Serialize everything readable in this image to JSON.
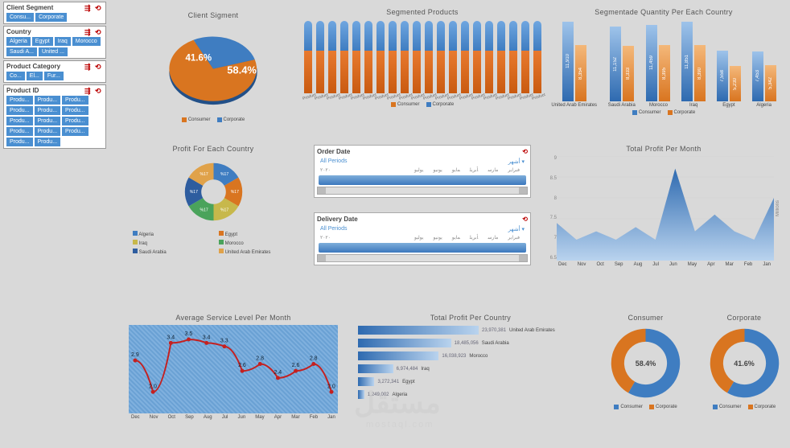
{
  "slicers": {
    "clientSegment": {
      "title": "Client Segment",
      "items": [
        "Consu...",
        "Corporate"
      ]
    },
    "country": {
      "title": "Country",
      "items": [
        "Algeria",
        "Egypt",
        "Iraq",
        "Morocco",
        "Saudi A...",
        "United ..."
      ]
    },
    "productCategory": {
      "title": "Product Category",
      "items": [
        "Co...",
        "El...",
        "Fur..."
      ]
    },
    "productId": {
      "title": "Product ID",
      "items": [
        "Produ...",
        "Produ...",
        "Produ...",
        "Produ...",
        "Produ...",
        "Produ...",
        "Produ...",
        "Produ...",
        "Produ...",
        "Produ...",
        "Produ...",
        "Produ...",
        "Produ...",
        "Produ..."
      ]
    }
  },
  "clientSegmentPie": {
    "title": "Client Sigment",
    "series": [
      {
        "name": "Consumer",
        "value": 58.4,
        "color": "#d97520"
      },
      {
        "name": "Corporate",
        "value": 41.6,
        "color": "#3f7dc1"
      }
    ],
    "leg": {
      "a": "Consumer",
      "b": "Corporate"
    }
  },
  "segmentedProducts": {
    "title": "Segmented Products",
    "categories": [
      "Product 01",
      "Product 02",
      "Product 03",
      "Product 04",
      "Product 05",
      "Product 06",
      "Product 07",
      "Product 08",
      "Product 09",
      "Product 10",
      "Product 11",
      "Product 12",
      "Product 13",
      "Product 14",
      "Product 15",
      "Product 16",
      "Product 17",
      "Product 18",
      "Product 19",
      "Product 20"
    ],
    "series": [
      {
        "name": "Consumer",
        "color": "#d97520",
        "values": [
          146,
          146,
          146,
          146,
          146,
          146,
          146,
          146,
          146,
          146,
          146,
          146,
          146,
          146,
          146,
          146,
          146,
          146,
          146,
          146
        ]
      },
      {
        "name": "Corporate",
        "color": "#3f7dc1",
        "values": [
          104,
          104,
          104,
          104,
          104,
          104,
          104,
          104,
          104,
          104,
          104,
          104,
          104,
          104,
          104,
          104,
          104,
          104,
          104,
          104
        ]
      }
    ],
    "leg": {
      "a": "Consumer",
      "b": "Corporate"
    }
  },
  "qtyCountry": {
    "title": "Segmentade Quantity Per Each Country",
    "categories": [
      "United Arab Emirates",
      "Saudi Arabia",
      "Morocco",
      "Iraq",
      "Egypt",
      "Algeria"
    ],
    "series": [
      {
        "name": "Consumer",
        "color": "#3f7dc1",
        "values": [
          11910,
          11152,
          11459,
          11851,
          7558,
          7453
        ]
      },
      {
        "name": "Corporate",
        "color": "#d97520",
        "values": [
          8354,
          8333,
          8395,
          8390,
          5230,
          5342
        ]
      }
    ],
    "leg": {
      "a": "Consumer",
      "b": "Corporate"
    }
  },
  "profitCountryDonut": {
    "title": "Profit For Each Country",
    "series": [
      {
        "name": "Algeria",
        "color": "#3f7dc1",
        "value": 16.7
      },
      {
        "name": "Egypt",
        "color": "#d97520",
        "value": 16.7
      },
      {
        "name": "Iraq",
        "color": "#c7b84b",
        "value": 16.7
      },
      {
        "name": "Morocco",
        "color": "#4aa35b",
        "value": 16.7
      },
      {
        "name": "Saudi Arabia",
        "color": "#2e5d9f",
        "value": 16.7
      },
      {
        "name": "United Arab Emirates",
        "color": "#e0a24a",
        "value": 16.7
      }
    ],
    "leg": {
      "a": "Algeria",
      "b": "Egypt",
      "c": "Iraq",
      "d": "Morocco",
      "e": "Saudi Arabia",
      "f": "United Arab Emirates"
    }
  },
  "orderDate": {
    "title": "Order Date",
    "sel": "All Periods",
    "unit": "أشهر",
    "year": "٢٠٢٠",
    "months": [
      "فبراير",
      "مارس",
      "أبريل",
      "مايو",
      "يونيو",
      "يوليو"
    ]
  },
  "deliveryDate": {
    "title": "Delivery Date",
    "sel": "All Periods",
    "unit": "أشهر",
    "year": "٢٠٢٠",
    "months": [
      "فبراير",
      "مارس",
      "أبريل",
      "مايو",
      "يونيو",
      "يوليو"
    ]
  },
  "profitMonth": {
    "title": "Total Profit Per Month",
    "ylabel": "Millions",
    "categories": [
      "Dec",
      "Nov",
      "Oct",
      "Sep",
      "Aug",
      "Jul",
      "Jun",
      "May",
      "Apr",
      "Mar",
      "Feb",
      "Jan"
    ],
    "values": [
      7.4,
      7.0,
      7.2,
      7.0,
      7.3,
      7.0,
      8.7,
      7.2,
      7.6,
      7.2,
      7.0,
      8.0
    ],
    "ylim": [
      6.5,
      9
    ],
    "yticks": [
      "9",
      "8.5",
      "8",
      "7.5",
      "7",
      "6.5"
    ]
  },
  "avgService": {
    "title": "Average Service Level Per Month",
    "categories": [
      "Dec",
      "Nov",
      "Oct",
      "Sep",
      "Aug",
      "Jul",
      "Jun",
      "May",
      "Apr",
      "Mar",
      "Feb",
      "Jan"
    ],
    "values": [
      2.9,
      2.0,
      3.4,
      3.5,
      3.4,
      3.3,
      2.6,
      2.8,
      2.4,
      2.6,
      2.8,
      2.0
    ],
    "ylim": [
      1.5,
      3.8
    ]
  },
  "profitCountryBar": {
    "title": "Total Profit Per Country",
    "categories": [
      "United Arab Emirates",
      "Saudi Arabia",
      "Morocco",
      "Iraq",
      "Egypt",
      "Algeria"
    ],
    "values": [
      23970381,
      18485056,
      16038923,
      6974484,
      3272341,
      1249002
    ]
  },
  "consumerRing": {
    "title": "Consumer",
    "center": "58.4%",
    "series": [
      {
        "name": "Consumer",
        "color": "#3f7dc1",
        "value": 58.4
      },
      {
        "name": "Corporate",
        "color": "#d97520",
        "value": 41.6
      }
    ],
    "leg": {
      "a": "Consumer",
      "b": "Corporate"
    }
  },
  "corporateRing": {
    "title": "Corporate",
    "center": "41.6%",
    "series": [
      {
        "name": "Consumer",
        "color": "#3f7dc1",
        "value": 58.4
      },
      {
        "name": "Corporate",
        "color": "#d97520",
        "value": 41.6
      }
    ],
    "leg": {
      "a": "Consumer",
      "b": "Corporate"
    }
  },
  "chart_data": [
    {
      "type": "pie",
      "title": "Client Sigment",
      "series": [
        {
          "name": "Consumer",
          "value": 58.4
        },
        {
          "name": "Corporate",
          "value": 41.6
        }
      ]
    },
    {
      "type": "bar",
      "title": "Segmented Products",
      "categories": [
        "P01",
        "P02",
        "P03",
        "P04",
        "P05",
        "P06",
        "P07",
        "P08",
        "P09",
        "P10",
        "P11",
        "P12",
        "P13",
        "P14",
        "P15",
        "P16",
        "P17",
        "P18",
        "P19",
        "P20"
      ],
      "series": [
        {
          "name": "Consumer",
          "values": [
            146,
            146,
            146,
            146,
            146,
            146,
            146,
            146,
            146,
            146,
            146,
            146,
            146,
            146,
            146,
            146,
            146,
            146,
            146,
            146
          ]
        },
        {
          "name": "Corporate",
          "values": [
            104,
            104,
            104,
            104,
            104,
            104,
            104,
            104,
            104,
            104,
            104,
            104,
            104,
            104,
            104,
            104,
            104,
            104,
            104,
            104
          ]
        }
      ],
      "stacked": true
    },
    {
      "type": "bar",
      "title": "Segmentade Quantity Per Each Country",
      "categories": [
        "United Arab Emirates",
        "Saudi Arabia",
        "Morocco",
        "Iraq",
        "Egypt",
        "Algeria"
      ],
      "series": [
        {
          "name": "Consumer",
          "values": [
            11910,
            11152,
            11459,
            11851,
            7558,
            7453
          ]
        },
        {
          "name": "Corporate",
          "values": [
            8354,
            8333,
            8395,
            8390,
            5230,
            5342
          ]
        }
      ]
    },
    {
      "type": "pie",
      "title": "Profit For Each Country",
      "series": [
        {
          "name": "Algeria",
          "value": 16.7
        },
        {
          "name": "Egypt",
          "value": 16.7
        },
        {
          "name": "Iraq",
          "value": 16.7
        },
        {
          "name": "Morocco",
          "value": 16.7
        },
        {
          "name": "Saudi Arabia",
          "value": 16.7
        },
        {
          "name": "United Arab Emirates",
          "value": 16.7
        }
      ]
    },
    {
      "type": "area",
      "title": "Total Profit Per Month",
      "x": [
        "Dec",
        "Nov",
        "Oct",
        "Sep",
        "Aug",
        "Jul",
        "Jun",
        "May",
        "Apr",
        "Mar",
        "Feb",
        "Jan"
      ],
      "y": [
        7.4,
        7.0,
        7.2,
        7.0,
        7.3,
        7.0,
        8.7,
        7.2,
        7.6,
        7.2,
        7.0,
        8.0
      ],
      "ylabel": "Millions",
      "ylim": [
        6.5,
        9
      ]
    },
    {
      "type": "line",
      "title": "Average Service Level Per Month",
      "x": [
        "Dec",
        "Nov",
        "Oct",
        "Sep",
        "Aug",
        "Jul",
        "Jun",
        "May",
        "Apr",
        "Mar",
        "Feb",
        "Jan"
      ],
      "y": [
        2.9,
        2.0,
        3.4,
        3.5,
        3.4,
        3.3,
        2.6,
        2.8,
        2.4,
        2.6,
        2.8,
        2.0
      ]
    },
    {
      "type": "bar",
      "title": "Total Profit Per Country",
      "orientation": "h",
      "categories": [
        "United Arab Emirates",
        "Saudi Arabia",
        "Morocco",
        "Iraq",
        "Egypt",
        "Algeria"
      ],
      "values": [
        23970381,
        18485056,
        16038923,
        6974484,
        3272341,
        1249002
      ]
    },
    {
      "type": "pie",
      "title": "Consumer",
      "series": [
        {
          "name": "Consumer",
          "value": 58.4
        },
        {
          "name": "Corporate",
          "value": 41.6
        }
      ]
    },
    {
      "type": "pie",
      "title": "Corporate",
      "series": [
        {
          "name": "Consumer",
          "value": 58.4
        },
        {
          "name": "Corporate",
          "value": 41.6
        }
      ]
    }
  ],
  "watermark": {
    "a": "مستقل",
    "b": "mostaql.com"
  }
}
